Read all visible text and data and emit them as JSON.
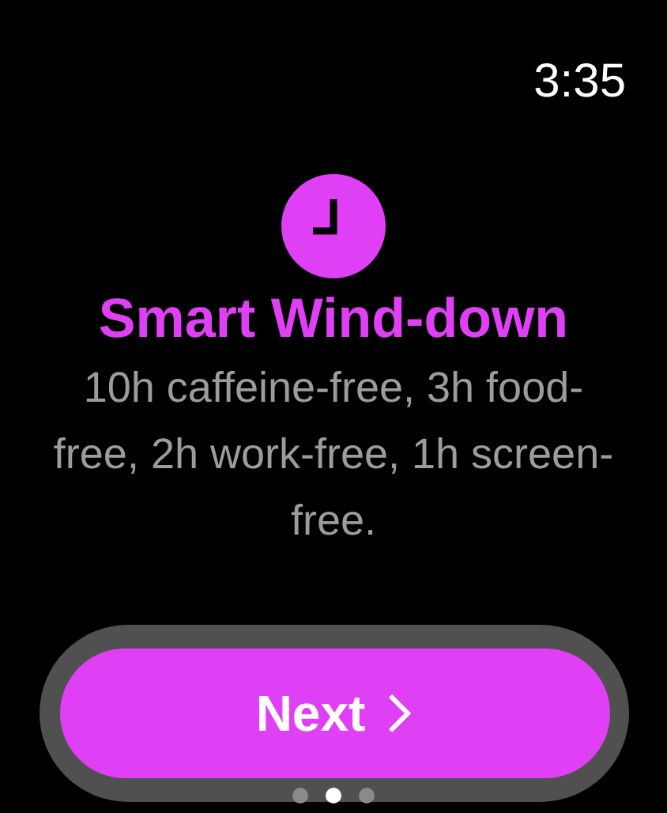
{
  "status_bar": {
    "time": "3:35"
  },
  "title": "Smart Wind-down",
  "description": "10h caffeine-free, 3h food-free, 2h work-free, 1h screen-free.",
  "button": {
    "label": "Next"
  },
  "page_dots": [
    {
      "selected": false
    },
    {
      "selected": true
    },
    {
      "selected": false
    }
  ]
}
